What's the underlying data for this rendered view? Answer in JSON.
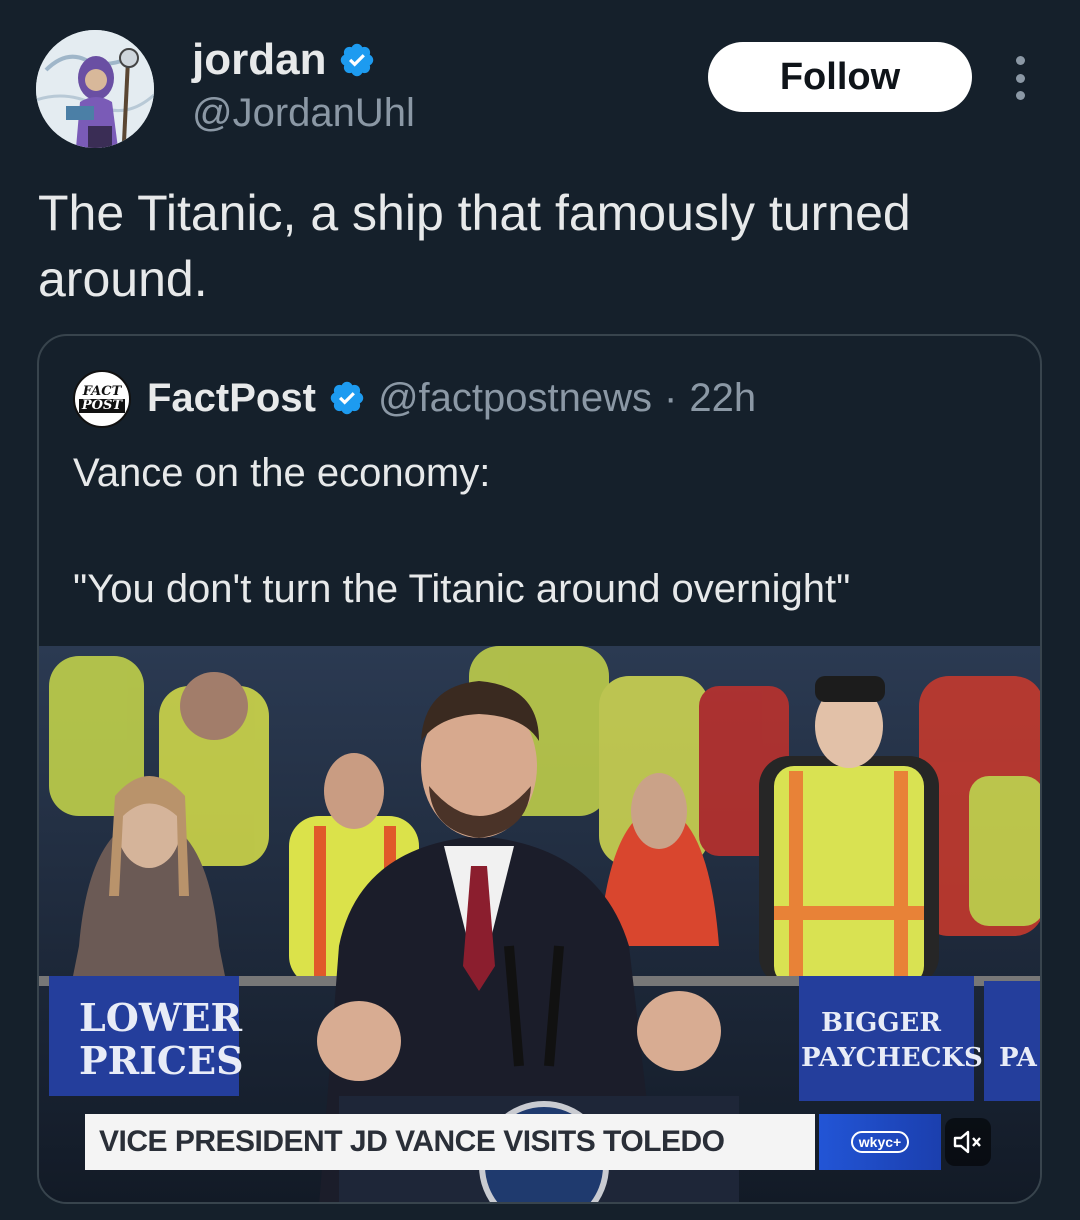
{
  "tweet": {
    "author": {
      "name": "jordan",
      "handle": "@JordanUhl",
      "verified": true
    },
    "follow_label": "Follow",
    "text": "The Titanic, a ship that famously turned around."
  },
  "quoted_tweet": {
    "avatar_text": [
      "FACT",
      "POST"
    ],
    "author_name": "FactPost",
    "handle": "@factpostnews",
    "separator": "·",
    "time": "22h",
    "text": "Vance on the economy:\n\n\"You don't turn the Titanic around overnight\"",
    "media": {
      "sign_left": [
        "LOWER",
        "PRICES"
      ],
      "sign_right": [
        "BIGGER",
        "PAYCHECKS"
      ],
      "sign_edge": "PA",
      "lower_third": "VICE PRESIDENT JD VANCE VISITS TOLEDO",
      "network_logo": "wkyc+",
      "mute_icon": "speaker-muted-icon"
    }
  },
  "colors": {
    "background": "#15202b",
    "text_primary": "#e7e9ea",
    "text_secondary": "#8b98a5",
    "verified": "#1d9bf0",
    "card_border": "#38444d"
  }
}
